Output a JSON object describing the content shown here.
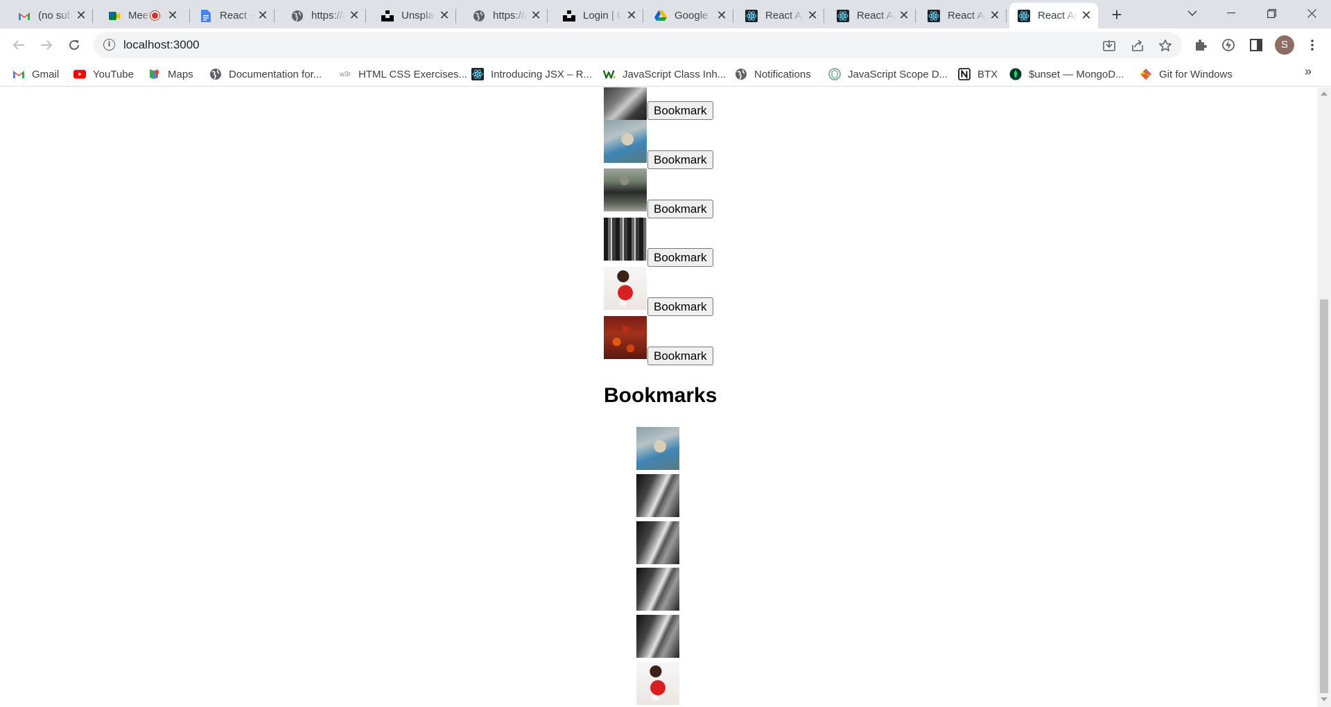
{
  "browser": {
    "tabs": [
      {
        "title": "(no subject)",
        "icon": "gmail-icon"
      },
      {
        "title": "Meet",
        "icon": "meet-icon",
        "recording": true
      },
      {
        "title": "React - Google Docs",
        "icon": "docs-icon"
      },
      {
        "title": "https://api.unsplash.com",
        "icon": "globe-icon"
      },
      {
        "title": "Unsplash",
        "icon": "unsplash-icon"
      },
      {
        "title": "https://api.unsplash.com",
        "icon": "globe-icon"
      },
      {
        "title": "Login | Unsplash",
        "icon": "unsplash-icon"
      },
      {
        "title": "Google Drive",
        "icon": "drive-icon"
      },
      {
        "title": "React App",
        "icon": "react-icon"
      },
      {
        "title": "React App",
        "icon": "react-icon"
      },
      {
        "title": "React App",
        "icon": "react-icon"
      },
      {
        "title": "React App",
        "icon": "react-icon",
        "active": true
      }
    ],
    "url": "localhost:3000",
    "avatar_letter": "S",
    "bookmarks": [
      {
        "label": "Gmail",
        "icon": "gmail-icon"
      },
      {
        "label": "YouTube",
        "icon": "youtube-icon"
      },
      {
        "label": "Maps",
        "icon": "maps-icon"
      },
      {
        "label": "Documentation for...",
        "icon": "globe-icon"
      },
      {
        "label": "HTML CSS Exercises...",
        "icon": "w3r-icon"
      },
      {
        "label": "Introducing JSX – R...",
        "icon": "react-icon"
      },
      {
        "label": "JavaScript Class Inh...",
        "icon": "w-icon"
      },
      {
        "label": "Notifications",
        "icon": "globe-icon"
      },
      {
        "label": "JavaScript Scope D...",
        "icon": "chatgpt-icon"
      },
      {
        "label": "BTX",
        "icon": "notion-icon"
      },
      {
        "label": "$unset — MongoD...",
        "icon": "mongodb-icon"
      },
      {
        "label": "Git for Windows",
        "icon": "git-icon"
      }
    ],
    "w3r_text": "w3r"
  },
  "page": {
    "bookmark_button_label": "Bookmark",
    "bookmarks_heading": "Bookmarks",
    "images": [
      "photo-a",
      "photo-b",
      "photo-c",
      "photo-d",
      "photo-e",
      "photo-f"
    ],
    "bookmarked_images": [
      "photo-b",
      "photo-g",
      "photo-g",
      "photo-g",
      "photo-g",
      "photo-e"
    ]
  },
  "colors": {
    "tabstrip_bg": "#dee1e6",
    "omnibox_bg": "#f1f3f4",
    "button_bg": "#efefef",
    "avatar_bg": "#8d6e63"
  }
}
